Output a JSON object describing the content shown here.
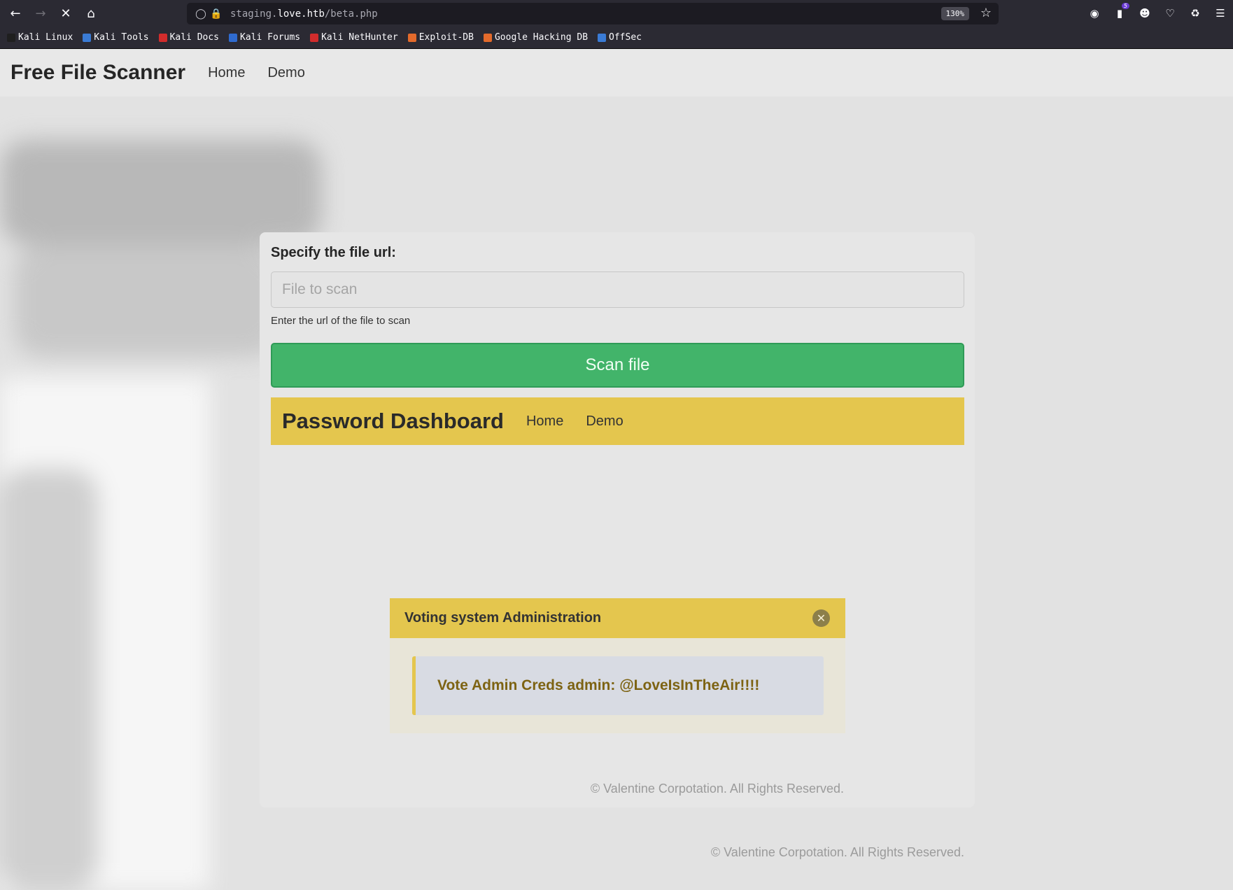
{
  "browser": {
    "url_prefix": "staging.",
    "url_domain": "love.htb",
    "url_path": "/beta.php",
    "zoom": "130%",
    "extension_badge": "5",
    "bookmarks": [
      {
        "label": "Kali Linux",
        "color": "#1f1f1f"
      },
      {
        "label": "Kali Tools",
        "color": "#3a7bd5"
      },
      {
        "label": "Kali Docs",
        "color": "#d22c2c"
      },
      {
        "label": "Kali Forums",
        "color": "#2f6bd0"
      },
      {
        "label": "Kali NetHunter",
        "color": "#d22c2c"
      },
      {
        "label": "Exploit-DB",
        "color": "#e36a2b"
      },
      {
        "label": "Google Hacking DB",
        "color": "#e36a2b"
      },
      {
        "label": "OffSec",
        "color": "#3a7bd5"
      }
    ]
  },
  "site": {
    "brand": "Free File Scanner",
    "nav": [
      "Home",
      "Demo"
    ]
  },
  "form": {
    "label": "Specify the file url:",
    "placeholder": "File to scan",
    "hint": "Enter the url of the file to scan",
    "button": "Scan file"
  },
  "dashboard": {
    "brand": "Password Dashboard",
    "nav": [
      "Home",
      "Demo"
    ]
  },
  "modal": {
    "title": "Voting system Administration",
    "credentials": "Vote Admin Creds admin: @LoveIsInTheAir!!!!"
  },
  "footer": {
    "inner": "© Valentine Corpotation. All Rights Reserved.",
    "outer": "© Valentine Corpotation. All Rights Reserved."
  },
  "colors": {
    "accent_yellow": "#e4c64e",
    "button_green": "#42b46a",
    "cred_text": "#7d6313"
  }
}
